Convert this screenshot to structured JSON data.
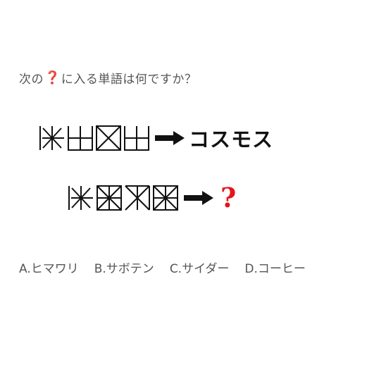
{
  "question": {
    "prefix": "次の",
    "icon_glyph": "❓",
    "suffix": "に入る単語は何ですか？"
  },
  "row1": {
    "answer": "コスモス"
  },
  "row2": {
    "answer": "?"
  },
  "options": [
    {
      "label": "A.ヒマワリ"
    },
    {
      "label": "B.サボテン"
    },
    {
      "label": "C.サイダー"
    },
    {
      "label": "D.コーヒー"
    }
  ],
  "colors": {
    "text": "#555555",
    "glyph": "#111111",
    "accent_red": "#e3161c"
  }
}
